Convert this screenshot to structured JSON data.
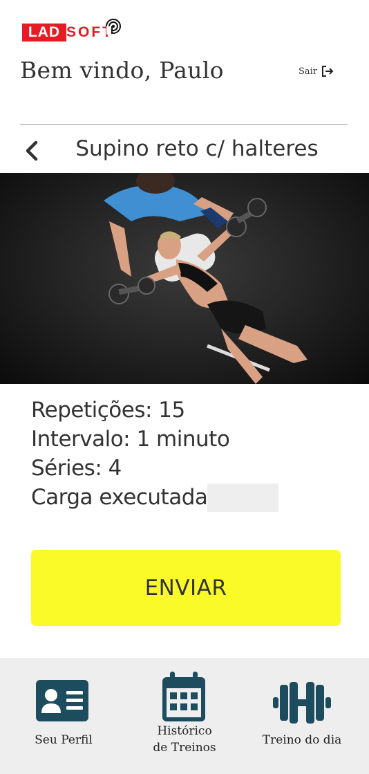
{
  "brand": {
    "part_a": "LAD",
    "part_b": "SOFT",
    "color_red": "#e51c23"
  },
  "header": {
    "welcome": "Bem vindo, Paulo",
    "logout_label": "Sair",
    "logout_icon": "logout-icon"
  },
  "exercise": {
    "back_icon": "chevron-left-icon",
    "title": "Supino reto c/ halteres",
    "photo_description_icon": "photo"
  },
  "details": {
    "repetitions": "Repetições: 15",
    "interval": "Intervalo: 1 minuto",
    "series": "Séries: 4",
    "load_label": "Carga executada:",
    "load_value": "",
    "load_placeholder": ""
  },
  "actions": {
    "send_label": "ENVIAR",
    "send_color": "#fafa28"
  },
  "nav": {
    "profile": {
      "label": "Seu Perfil",
      "icon": "id-card-icon"
    },
    "history": {
      "label_line1": "Histórico",
      "label_line2": "de Treinos",
      "icon": "calendar-icon"
    },
    "today": {
      "label": "Treino do dia",
      "icon": "dumbbell-icon"
    },
    "icon_color": "#1c4c5e",
    "background": "#eeeeee"
  }
}
